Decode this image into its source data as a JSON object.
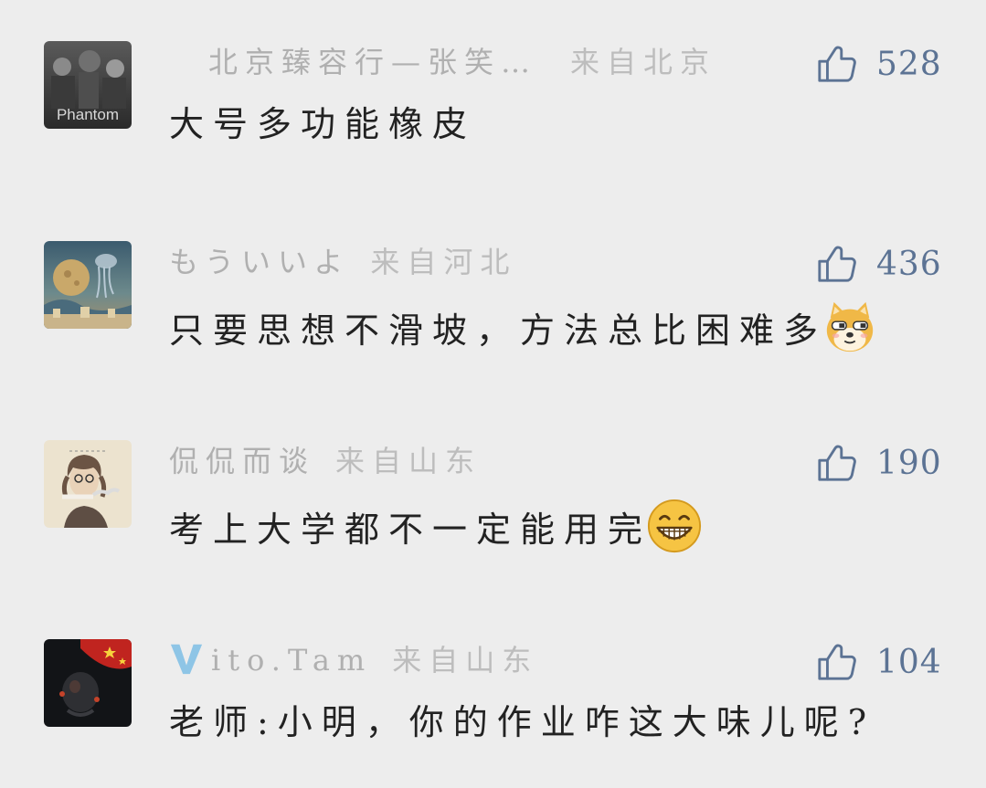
{
  "comments": [
    {
      "username": "北京臻容行—张笑…",
      "location": "来自北京",
      "likes": "528",
      "text": "大号多功能橡皮",
      "avatar_text": "Phantom",
      "emoji": null
    },
    {
      "username": "もういいよ",
      "location": "来自河北",
      "likes": "436",
      "text": "只要思想不滑坡，方法总比困难多",
      "emoji": "doge-emoji"
    },
    {
      "username": "侃侃而谈",
      "location": "来自山东",
      "likes": "190",
      "text": "考上大学都不一定能用完",
      "emoji": "grin-emoji"
    },
    {
      "username": "ito.Tam",
      "location": "来自山东",
      "likes": "104",
      "text": "老师:小明，你的作业咋这大味儿呢?",
      "emoji": null
    }
  ],
  "colors": {
    "background": "#ededed",
    "like_count": "#5c7394",
    "meta_text": "#b3b3b3",
    "body_text": "#222222",
    "verified_badge": "#8ec5e6"
  }
}
